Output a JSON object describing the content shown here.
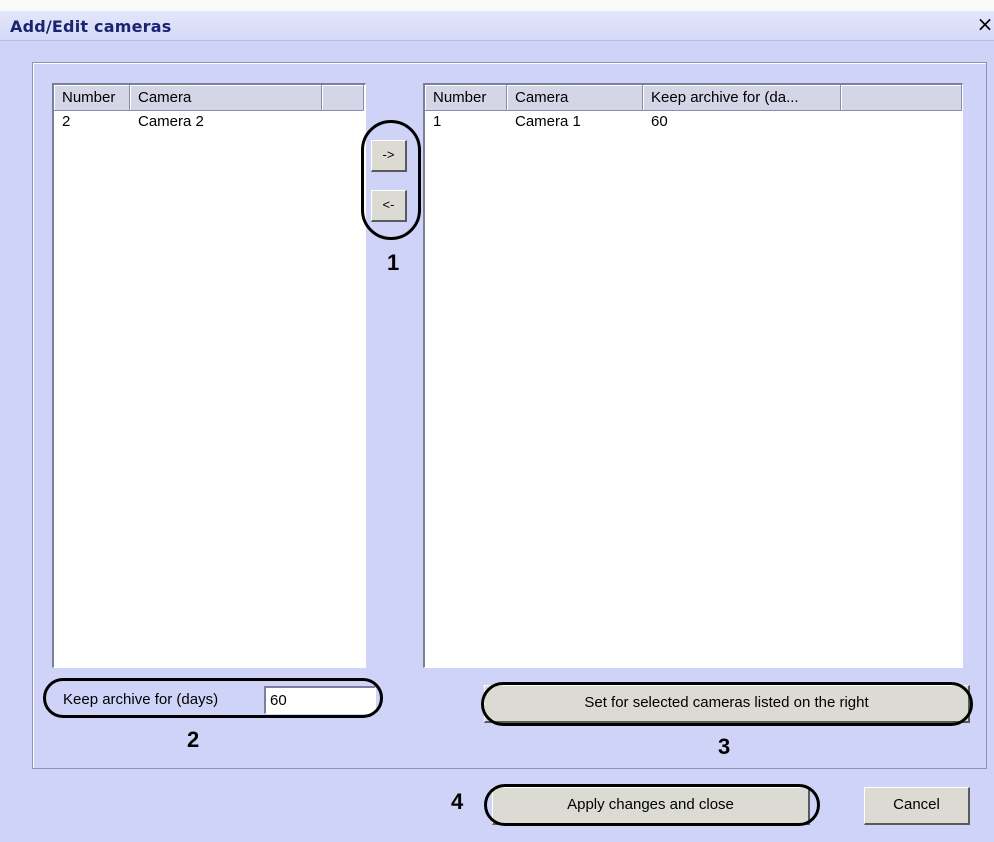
{
  "window": {
    "title": "Add/Edit cameras",
    "close_label": "×"
  },
  "left_list": {
    "columns": [
      "Number",
      "Camera"
    ],
    "rows": [
      {
        "number": "2",
        "camera": "Camera 2"
      }
    ]
  },
  "right_list": {
    "columns": [
      "Number",
      "Camera",
      "Keep archive for (da..."
    ],
    "rows": [
      {
        "number": "1",
        "camera": "Camera 1",
        "keep": "60"
      }
    ]
  },
  "transfer": {
    "move_right_label": "->",
    "move_left_label": "<-"
  },
  "archive": {
    "label": "Keep archive for (days)",
    "value": "60"
  },
  "buttons": {
    "set_label": "Set for selected cameras listed on the right",
    "apply_label": "Apply changes and close",
    "cancel_label": "Cancel"
  },
  "callouts": {
    "one": "1",
    "two": "2",
    "three": "3",
    "four": "4"
  },
  "colors": {
    "window_bg": "#cfd3f8",
    "title_text": "#1a2470",
    "button_face": "#dcdbd3"
  }
}
